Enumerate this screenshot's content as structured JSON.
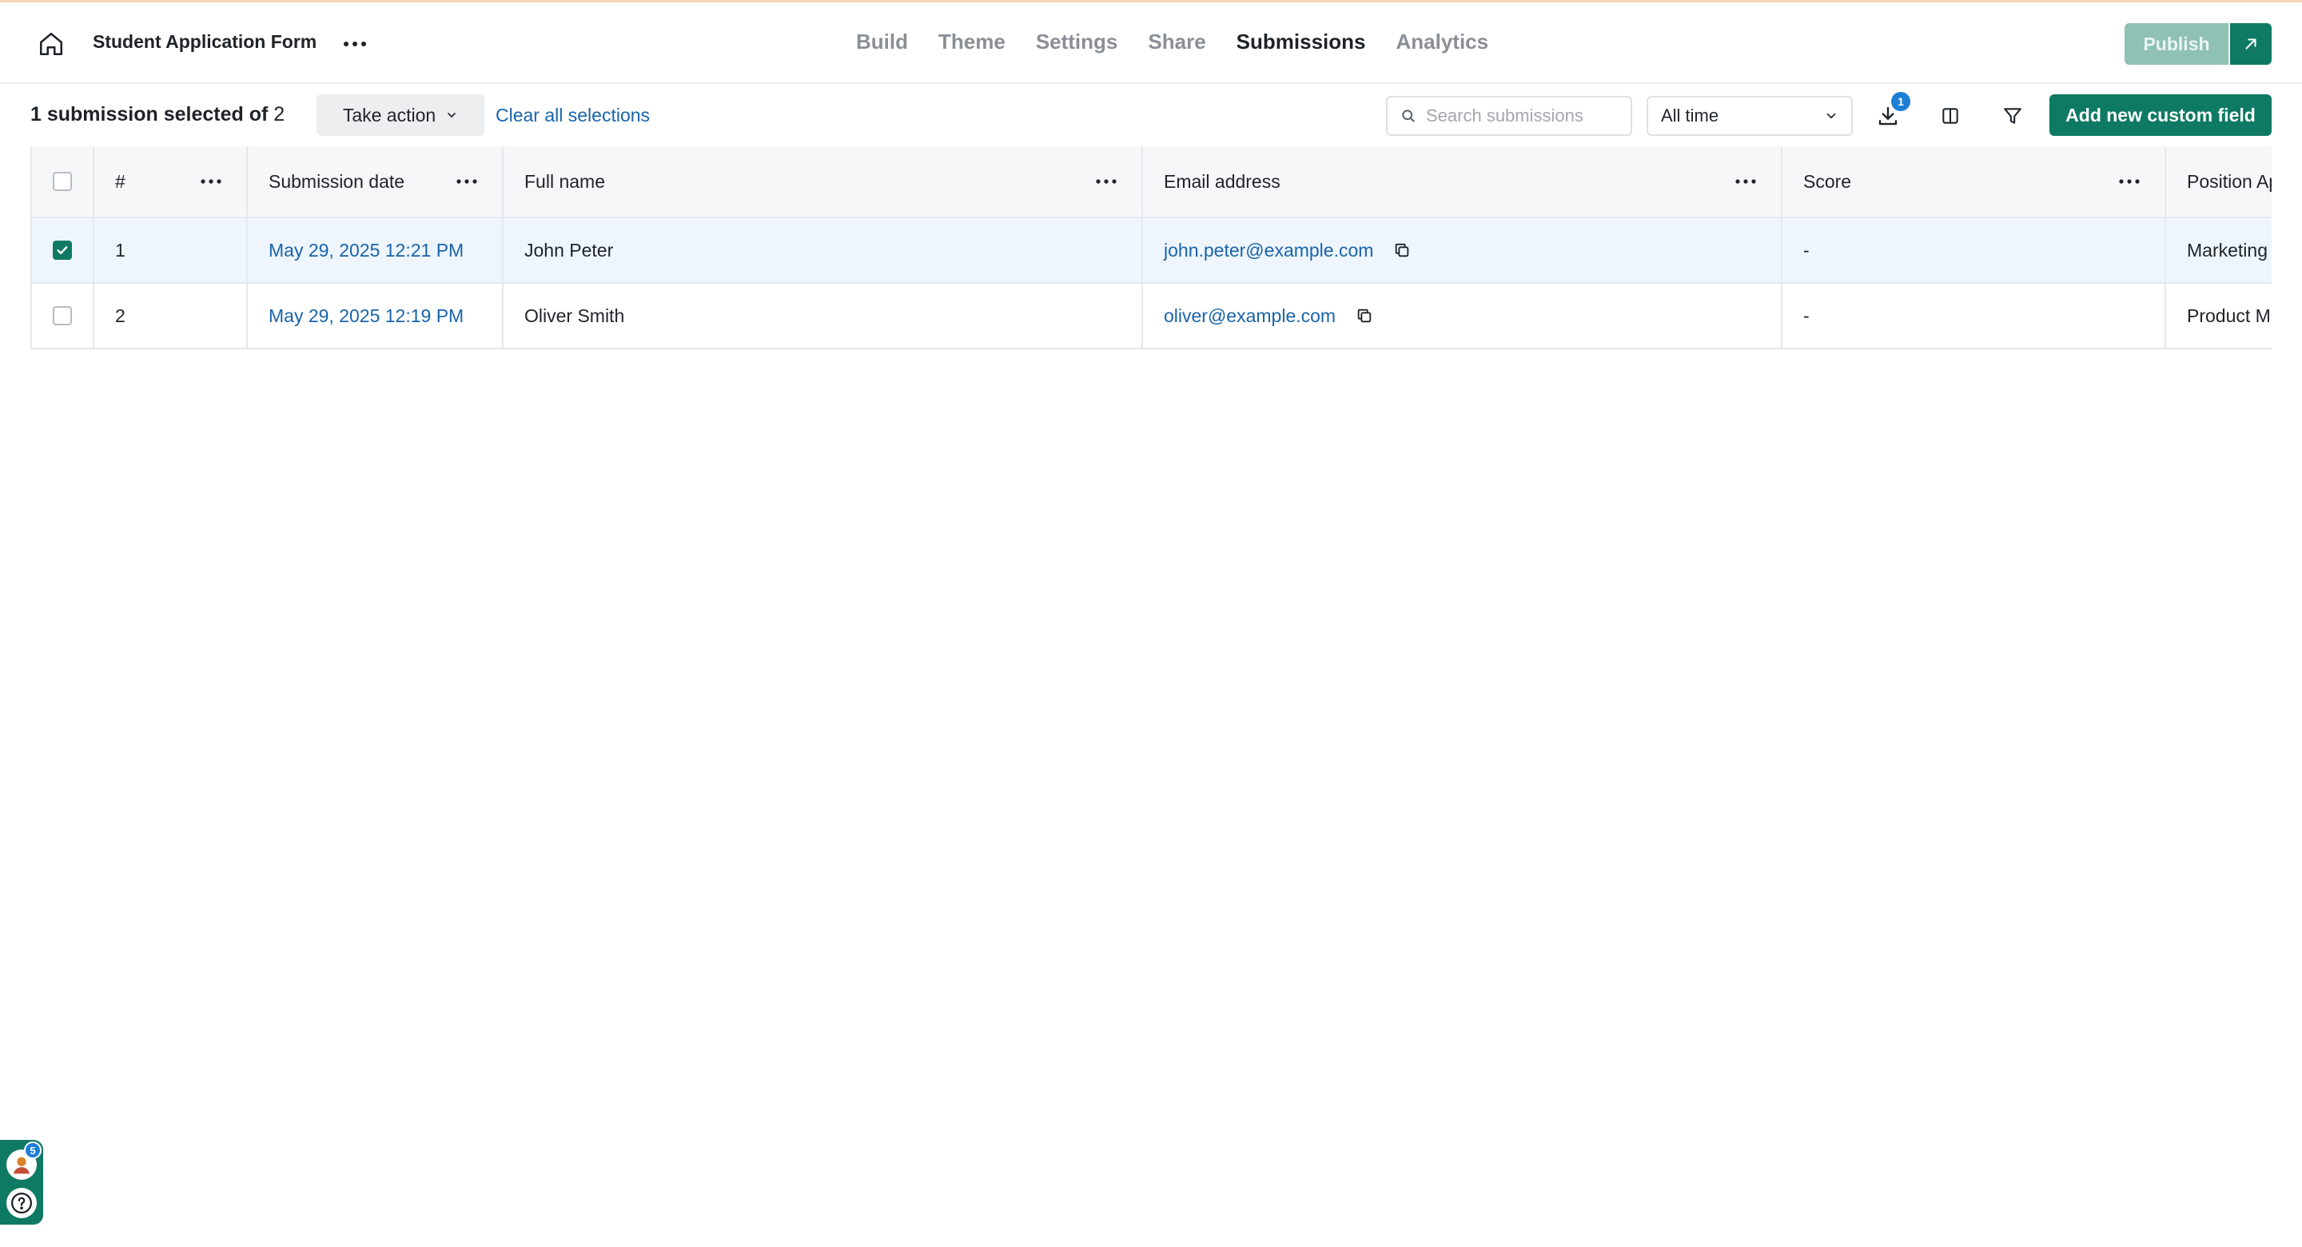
{
  "header": {
    "form_title": "Student Application Form",
    "tabs": [
      {
        "label": "Build",
        "active": false
      },
      {
        "label": "Theme",
        "active": false
      },
      {
        "label": "Settings",
        "active": false
      },
      {
        "label": "Share",
        "active": false
      },
      {
        "label": "Submissions",
        "active": true
      },
      {
        "label": "Analytics",
        "active": false
      }
    ],
    "publish_label": "Publish"
  },
  "toolbar": {
    "selection_prefix": "1 submission selected of",
    "selection_total": "2",
    "take_action_label": "Take action",
    "clear_all_label": "Clear all selections",
    "search_placeholder": "Search submissions",
    "time_filter_value": "All time",
    "download_badge": "1",
    "add_field_label": "Add new custom field"
  },
  "table": {
    "columns": [
      "#",
      "Submission date",
      "Full name",
      "Email address",
      "Score",
      "Position Ap"
    ],
    "rows": [
      {
        "selected": true,
        "num": "1",
        "date": "May 29, 2025 12:21 PM",
        "name": "John Peter",
        "email": "john.peter@example.com",
        "score": "-",
        "position": "Marketing"
      },
      {
        "selected": false,
        "num": "2",
        "date": "May 29, 2025 12:19 PM",
        "name": "Oliver Smith",
        "email": "oliver@example.com",
        "score": "-",
        "position": "Product M"
      }
    ]
  },
  "widget": {
    "notification_count": "5"
  },
  "colors": {
    "brand": "#0f7a63",
    "link": "#1864ab",
    "selected_row": "#eef5fd"
  }
}
